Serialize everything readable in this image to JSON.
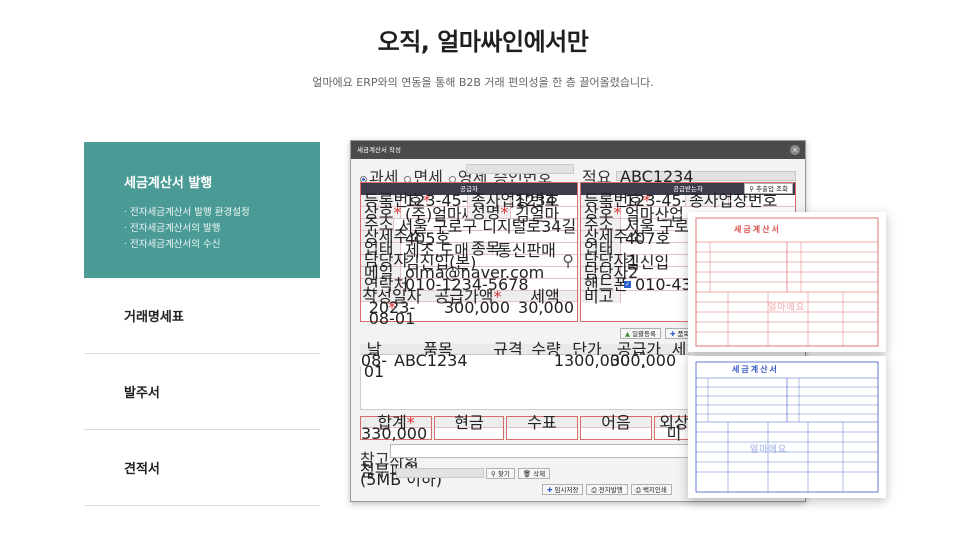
{
  "hero": {
    "title": "오직, 얼마싸인에서만",
    "subtitle": "얼마에요 ERP와의 연동을 통해 B2B 거래 편의성을 한 층 끌어올렸습니다."
  },
  "menu": {
    "active": {
      "title": "세금계산서 발행",
      "bullets": [
        "· 전자세금계산서 발행 환경설정",
        "· 전자세금계산서의 발행",
        "· 전자세금계산서의 수신"
      ]
    },
    "items": [
      "거래명세표",
      "발주서",
      "견적서"
    ]
  },
  "window": {
    "title": "세금계산서 작성",
    "close": "×",
    "radios": [
      "과세",
      "면세",
      "영세"
    ],
    "approval_label": "승인번호",
    "memo_label": "적요",
    "memo_value": "ABC1234",
    "supplier": {
      "head": "공급자",
      "reg_label": "등록번호",
      "reg_value": "123-45-67890",
      "sub_label": "종사업장번호",
      "sub_value": "1234",
      "name_label": "상호",
      "name_value": "(주)얼마싸인",
      "ceo_label": "성명",
      "ceo_value": "김얼마",
      "addr_label": "주소",
      "addr_value": "서울 구로구 디지털로34길 55 코오롱싸이언스밸리2차",
      "addr2_label": "상세주소",
      "addr2_value": "405호",
      "biz_label": "업태",
      "biz_value": "제조,도매,서비스",
      "item_label": "종목",
      "item_value": "통신판매",
      "mgr_label": "담당자",
      "mgr_value": "김신입(본)",
      "mail_label": "메일",
      "mail_value": "olma@naver.com",
      "tel_label": "연락처",
      "tel_value": "010-1234-5678"
    },
    "receiver": {
      "head": "공급받는자",
      "search_btn": "추출업 조회",
      "reg_label": "등록번호",
      "reg_value": "123-45-67890",
      "sub_label": "종사업장번호",
      "name_label": "상호",
      "name_value": "얼마산업",
      "addr_label": "주소",
      "addr_value": "서울 구로구 디지털로34",
      "addr2_label": "상세주소",
      "addr2_value": "407호",
      "biz_label": "업태",
      "mgr1_label": "담당자1",
      "mgr1_value": "김신입",
      "mgr2_label": "담당자2",
      "phone_label": "핸드폰",
      "phone_value": "010-4321-9876",
      "note_label": "비고"
    },
    "date_block": {
      "date_label": "작성일자",
      "date_value": "2023-08-01",
      "supply_label": "공급가액",
      "supply_value": "300,000",
      "tax_label": "세액",
      "tax_value": "30,000"
    },
    "actions": {
      "bulk": "일괄등록",
      "add": "품목"
    },
    "table": {
      "headers": [
        "날짜",
        "품목",
        "규격",
        "수량",
        "단가",
        "공급가액",
        "세"
      ],
      "rows": [
        [
          "08-01",
          "ABC1234",
          "",
          "1",
          "300,000",
          "300,000",
          ""
        ]
      ]
    },
    "summary": {
      "headers": [
        "합계",
        "현금",
        "수표",
        "어음",
        "외상미"
      ],
      "total_value": "330,000"
    },
    "ref_label": "참고사항",
    "attach_label": "첨부파일",
    "attach_hint": "(5MB 이하)",
    "find_btn": "찾기",
    "delete_btn": "삭제",
    "footer_buttons": [
      "임시저장",
      "전자발행",
      "백지인쇄"
    ]
  },
  "papers": {
    "red_title": "세금계산서",
    "blue_title": "세금계산서",
    "watermark": "얼마에요"
  },
  "colors": {
    "accent": "#4a9b95",
    "red_form": "#d9534f",
    "blue_form": "#3b5bc9"
  }
}
